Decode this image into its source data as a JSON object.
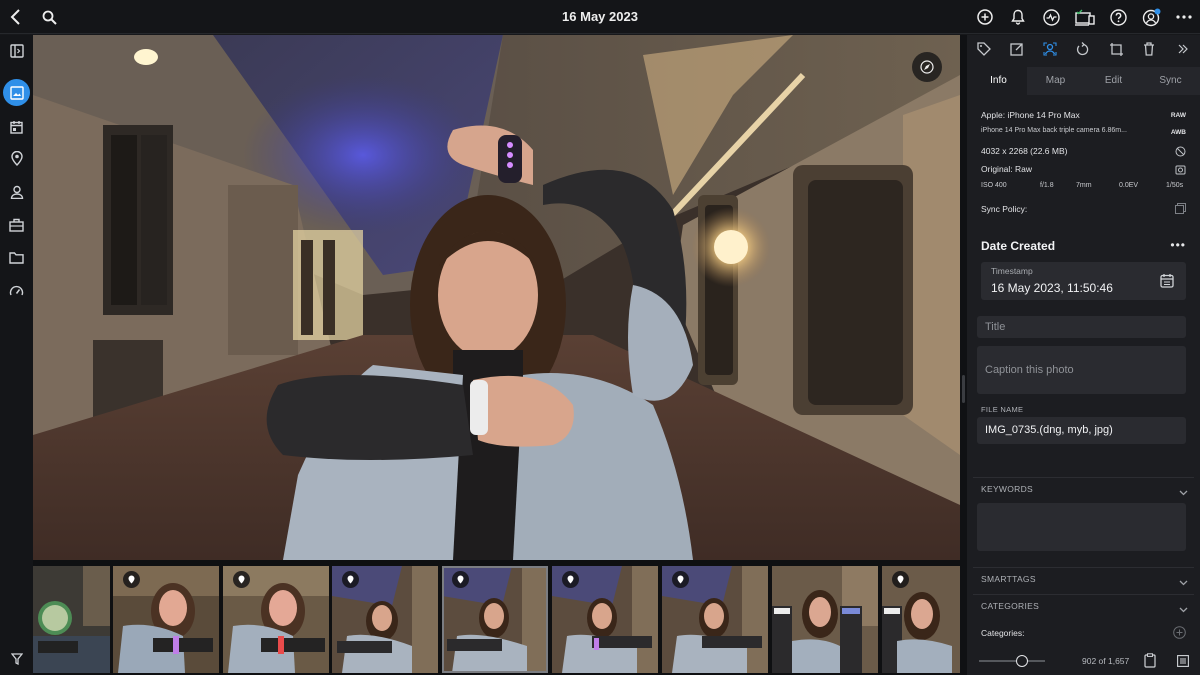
{
  "topbar": {
    "title": "16 May 2023",
    "icons": [
      "back-icon",
      "search-icon",
      "add-icon",
      "bell-icon",
      "activity-icon",
      "devices-icon",
      "help-icon",
      "account-icon",
      "more-icon"
    ]
  },
  "rail": {
    "items": [
      "panel-toggle-icon",
      "photos-icon",
      "calendar-icon",
      "places-icon",
      "people-icon",
      "albums-icon",
      "folders-icon",
      "dashboard-icon",
      "filter-icon"
    ],
    "active": "photos-icon"
  },
  "panel": {
    "tabs": [
      "Info",
      "Map",
      "Edit",
      "Sync"
    ],
    "active_tab": "Info",
    "camera": "Apple: iPhone 14 Pro Max",
    "raw_badge": "RAW",
    "lens": "iPhone 14 Pro Max back triple camera 6.86m...",
    "awb_badge": "AWB",
    "dimensions": "4032 x 2268 (22.6 MB)",
    "original": "Original: Raw",
    "exif": {
      "iso": "ISO 400",
      "aperture": "f/1.8",
      "focal": "7mm",
      "ev": "0.0EV",
      "shutter": "1/50s"
    },
    "sync_policy": "Sync Policy:",
    "date_section": "Date Created",
    "more": "•••",
    "timestamp_label": "Timestamp",
    "timestamp_value": "16 May 2023, 11:50:46",
    "title_placeholder": "Title",
    "caption_placeholder": "Caption this photo",
    "file_name_label": "FILE NAME",
    "file_name_value": "IMG_0735.(dng, myb, jpg)",
    "keywords_label": "KEYWORDS",
    "smarttags_label": "SMARTTAGS",
    "categories_label": "CATEGORIES",
    "categories_field": "Categories:",
    "counter": "902 of 1,657",
    "zoom_slider_value": 0.65
  },
  "colors": {
    "accent": "#2f8fe8",
    "panel": "#1c1d21",
    "bar": "#141518"
  }
}
